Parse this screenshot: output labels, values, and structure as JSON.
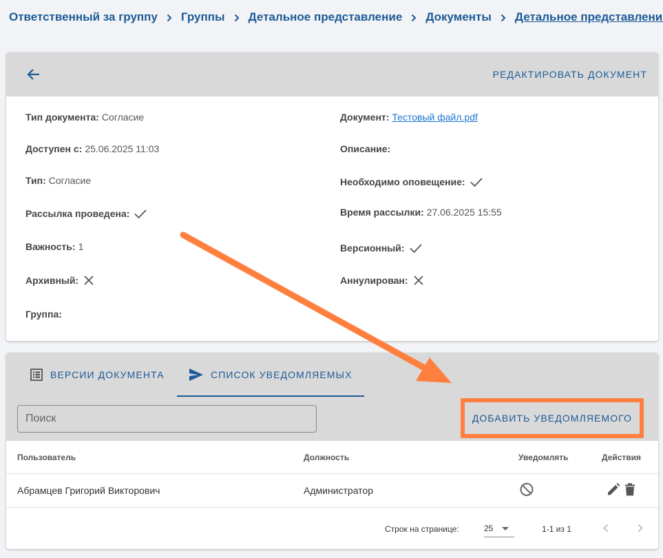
{
  "breadcrumb": [
    {
      "label": "Ответственный за группу"
    },
    {
      "label": "Группы"
    },
    {
      "label": "Детальное представление"
    },
    {
      "label": "Документы"
    },
    {
      "label": "Детальное представление"
    }
  ],
  "document_card": {
    "edit_label": "РЕДАКТИРОВАТЬ ДОКУМЕНТ",
    "fields": {
      "doc_type": {
        "label": "Тип документа:",
        "value": "Согласие"
      },
      "available_from": {
        "label": "Доступен с:",
        "value": "25.06.2025 11:03"
      },
      "type": {
        "label": "Тип:",
        "value": "Согласие"
      },
      "mailing_done": {
        "label": "Рассылка проведена:",
        "icon": "check-icon"
      },
      "importance": {
        "label": "Важность:",
        "value": "1"
      },
      "archived": {
        "label": "Архивный:",
        "icon": "cross-icon"
      },
      "group": {
        "label": "Группа:",
        "value": ""
      },
      "document": {
        "label": "Документ:",
        "value": "Тестовый файл.pdf"
      },
      "description": {
        "label": "Описание:",
        "value": ""
      },
      "notification_required": {
        "label": "Необходимо оповещение:",
        "icon": "check-icon"
      },
      "mailing_time": {
        "label": "Время рассылки:",
        "value": "27.06.2025 15:55"
      },
      "versioned": {
        "label": "Версионный:",
        "icon": "check-icon"
      },
      "annulled": {
        "label": "Аннулирован:",
        "icon": "cross-icon"
      }
    }
  },
  "tabs": [
    {
      "label": "ВЕРСИИ ДОКУМЕНТА",
      "icon": "list-icon",
      "active": false
    },
    {
      "label": "СПИСОК УВЕДОМЛЯЕМЫХ",
      "icon": "send-icon",
      "active": true
    }
  ],
  "search": {
    "placeholder": "Поиск",
    "value": ""
  },
  "add_button_label": "ДОБАВИТЬ УВЕДОМЛЯЕМОГО",
  "table": {
    "columns": [
      "Пользователь",
      "Должность",
      "Уведомлять",
      "Действия"
    ],
    "rows": [
      {
        "user": "Абрамцев Григорий Викторович",
        "position": "Администратор",
        "notify_icon": "block-icon",
        "actions": [
          "edit-icon",
          "delete-icon"
        ]
      }
    ]
  },
  "pagination": {
    "rows_per_page_label": "Строк на странице:",
    "rows_per_page": "25",
    "range": "1-1 из 1"
  },
  "colors": {
    "accent": "#1c5a96",
    "highlight": "#ff7f3f",
    "header_bg": "#d9d9d9",
    "link": "#1976d2"
  }
}
